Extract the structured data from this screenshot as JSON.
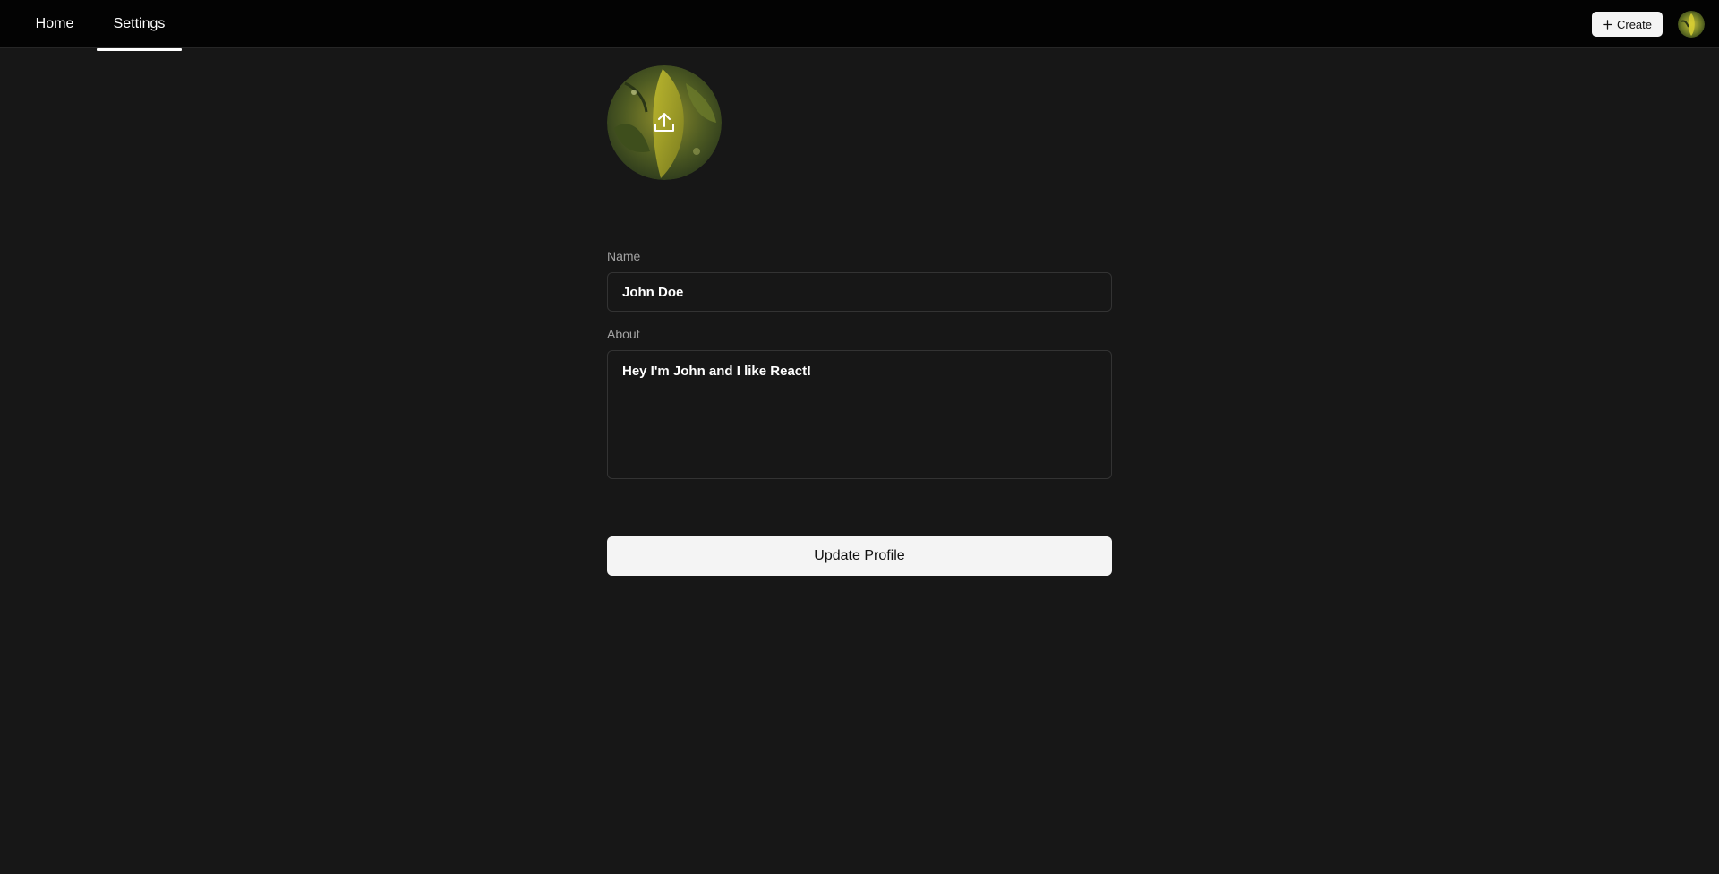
{
  "nav": {
    "tabs": [
      {
        "label": "Home",
        "active": false
      },
      {
        "label": "Settings",
        "active": true
      }
    ],
    "create_label": "Create",
    "create_icon": "plus-icon",
    "avatar_icon": "user-avatar"
  },
  "profile": {
    "avatar_overlay_icon": "upload-icon",
    "name_label": "Name",
    "name_value": "John Doe",
    "about_label": "About",
    "about_value": "Hey I'm John and I like React!",
    "submit_label": "Update Profile"
  },
  "colors": {
    "background": "#171717",
    "topbar": "#030303",
    "button_bg": "#f4f4f4",
    "input_border": "#333333",
    "label_text": "#a3a3a3"
  }
}
